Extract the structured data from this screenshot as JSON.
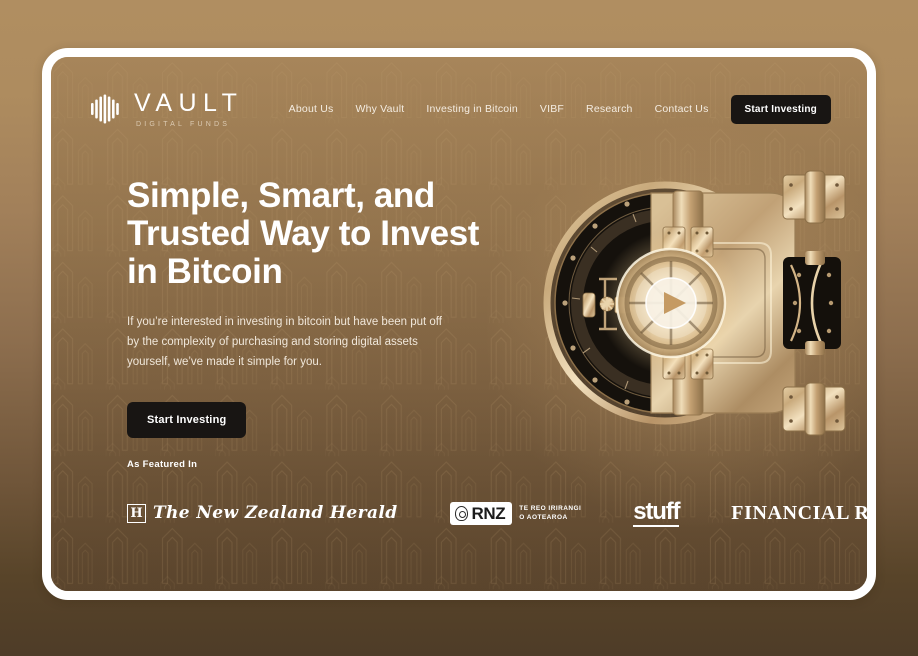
{
  "brand": {
    "name": "VAULT",
    "tagline": "DIGITAL FUNDS",
    "mark_icon": "vault-bars-logo-icon"
  },
  "nav": {
    "items": [
      {
        "label": "About Us"
      },
      {
        "label": "Why  Vault"
      },
      {
        "label": "Investing in Bitcoin"
      },
      {
        "label": "VIBF"
      },
      {
        "label": "Research"
      },
      {
        "label": "Contact Us"
      }
    ],
    "cta_label": "Start Investing"
  },
  "hero": {
    "headline": "Simple, Smart, and Trusted Way to Invest in Bitcoin",
    "paragraph": "If you’re interested in investing in bitcoin but have been put off by the complexity of purchasing and storing digital assets yourself, we’ve made it simple for you.",
    "cta_label": "Start Investing",
    "media": {
      "icon": "vault-door-image",
      "play_button_icon": "play-icon",
      "alt": "Gold bank vault door with play button"
    }
  },
  "featured": {
    "label": "As Featured In",
    "logos": [
      {
        "name": "the-new-zealand-herald",
        "badge": "H",
        "text": "The New Zealand Herald"
      },
      {
        "name": "rnz",
        "text": "RNZ",
        "tagline_line1": "TE REO IRIRANGI",
        "tagline_line2": "O AOTEAROA",
        "icon": "rnz-koru-icon"
      },
      {
        "name": "stuff",
        "text": "stuff"
      },
      {
        "name": "financial-review",
        "text": "FINANCIAL REVIEW"
      }
    ]
  },
  "colors": {
    "page_backdrop_top": "#b08e61",
    "page_backdrop_bottom": "#4e3c28",
    "frame_border": "#ffffff",
    "hero_bg_top": "#9e7d53",
    "hero_bg_bottom": "#614a31",
    "button_dark": "#181513",
    "text_light": "#ffffff",
    "text_muted": "#f0e7da",
    "vault_gold": "#c3a276",
    "vault_gold_light": "#f0dcb6",
    "vault_dark": "#16120e"
  }
}
